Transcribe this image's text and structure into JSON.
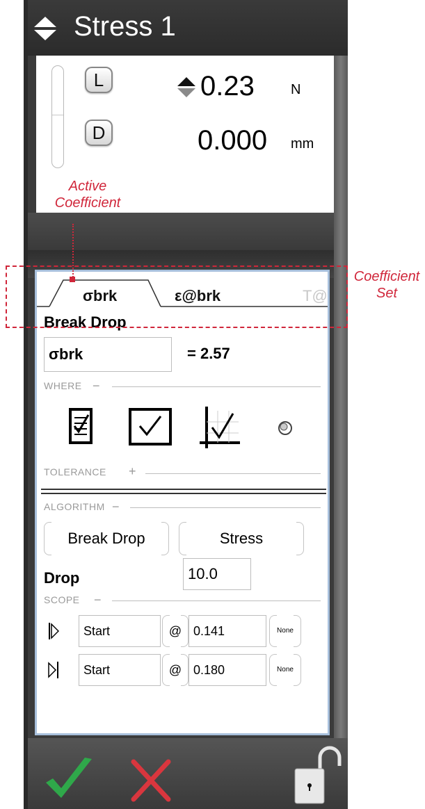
{
  "header": {
    "title": "Stress 1",
    "title_icon": "sort-arrows-icon"
  },
  "readout": {
    "load_button": "L",
    "disp_button": "D",
    "load_value": "0.23",
    "load_unit": "N",
    "disp_value": "0.000",
    "disp_unit": "mm"
  },
  "tabs": [
    {
      "label": "σbrk",
      "active": true
    },
    {
      "label": "ε@brk",
      "active": false
    },
    {
      "label": "T@b",
      "active": false
    }
  ],
  "coefficient": {
    "heading": "Break Drop",
    "name_value": "σbrk",
    "result": "= 2.57"
  },
  "sections": {
    "where": "WHERE",
    "where_toggle": "−",
    "tolerance": "TOLERANCE",
    "tolerance_toggle": "+",
    "algorithm": "ALGORITHM",
    "algorithm_toggle": "−",
    "scope": "SCOPE",
    "scope_toggle": "−"
  },
  "where_icons": [
    "checklist-icon",
    "checkbox-icon",
    "chart-check-icon",
    "sphere-icon"
  ],
  "algorithm": {
    "method": "Break Drop",
    "channel": "Stress",
    "drop_label": "Drop",
    "drop_value": "10.0"
  },
  "scope": {
    "rows": [
      {
        "icon": "scope-start-icon",
        "ref": "Start",
        "at": "@",
        "value": "0.141",
        "unit": "None"
      },
      {
        "icon": "scope-end-icon",
        "ref": "Start",
        "at": "@",
        "value": "0.180",
        "unit": "None"
      }
    ]
  },
  "footer": {
    "accept_icon": "checkmark-icon",
    "cancel_icon": "x-icon",
    "lock_icon": "unlock-icon"
  },
  "annotations": {
    "active_line1": "Active",
    "active_line2": "Coefficient",
    "set_line1": "Coefficient",
    "set_line2": "Set",
    "color": "#d0263a"
  }
}
